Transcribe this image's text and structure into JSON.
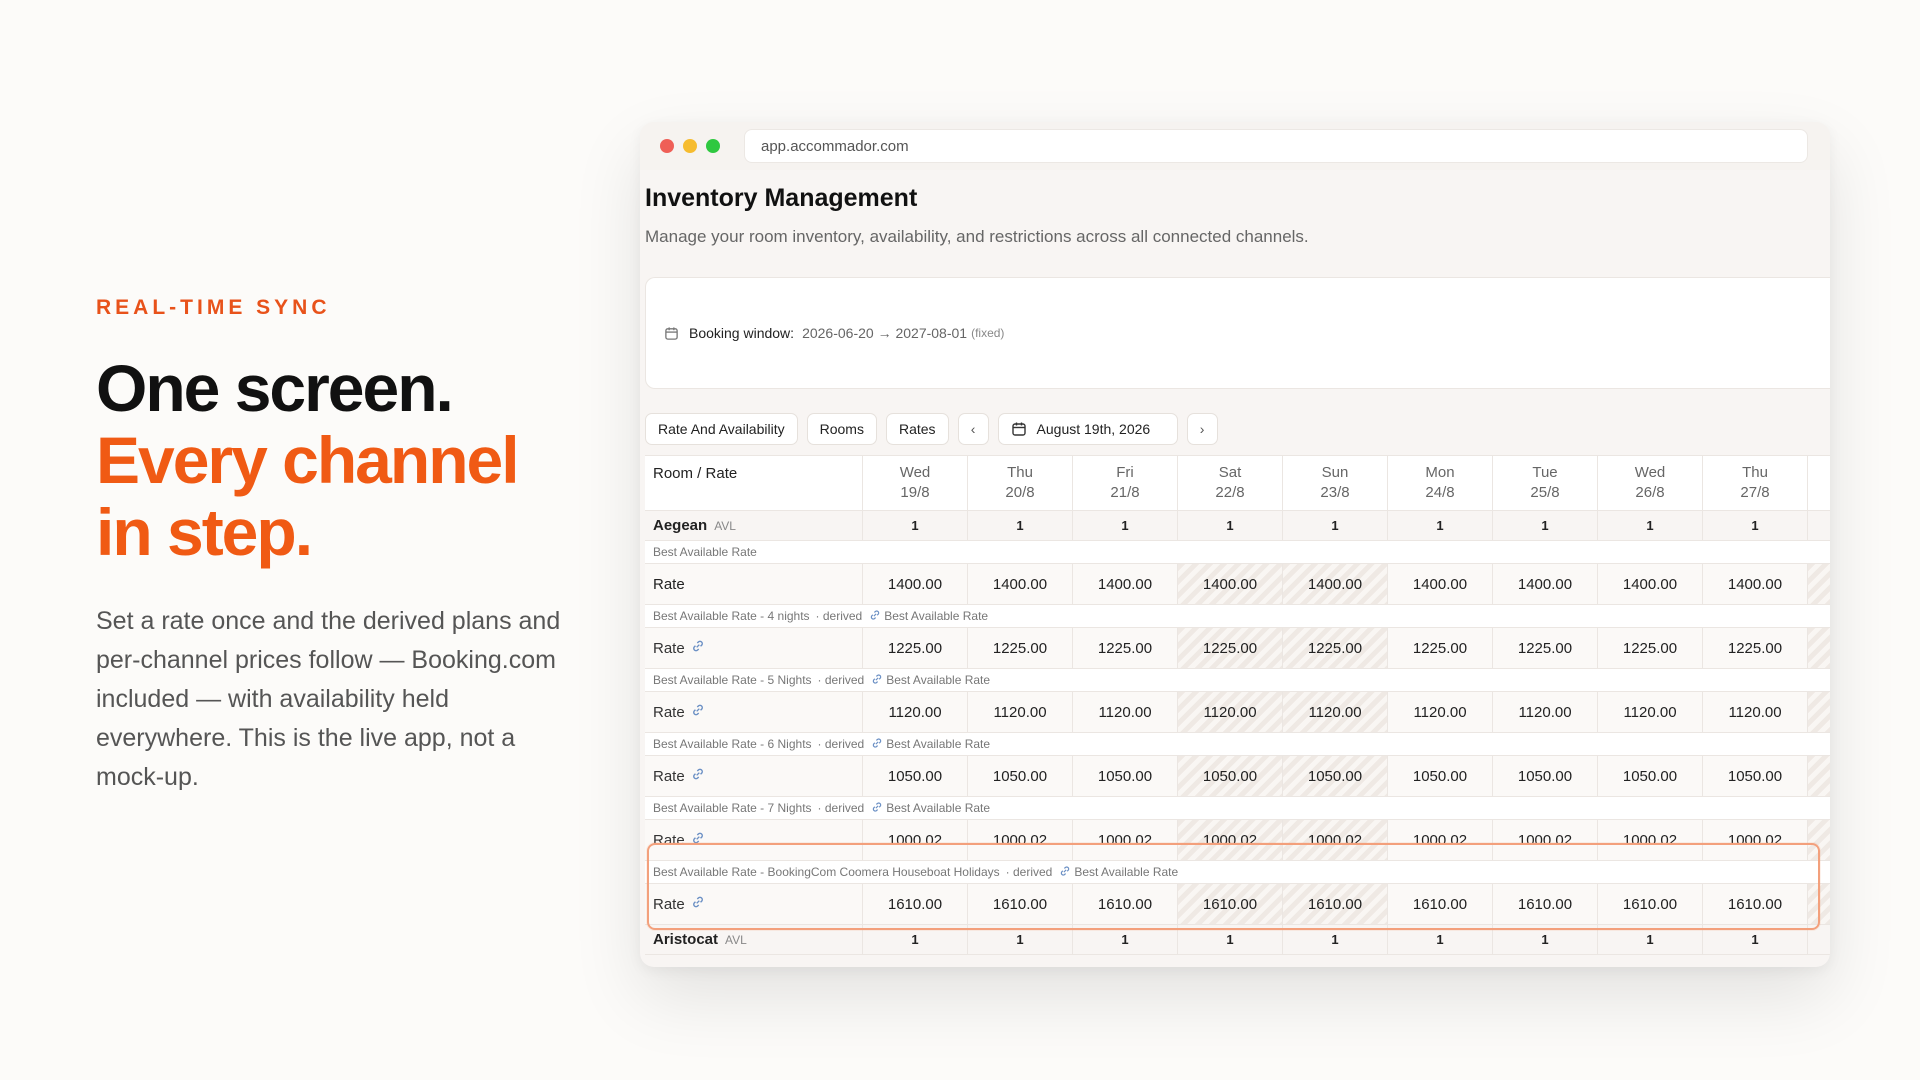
{
  "hero": {
    "eyebrow": "REAL-TIME SYNC",
    "headline_1": "One screen.",
    "headline_2": "Every channel",
    "headline_3": "in step.",
    "lede": "Set a rate once and the derived plans and per-channel prices follow — Booking.com included — with availability held everywhere. This is the live app, not a mock-up."
  },
  "browser": {
    "url": "app.accommador.com"
  },
  "page": {
    "title": "Inventory Management",
    "subtitle": "Manage your room inventory, availability, and restrictions across all connected channels."
  },
  "booking_window": {
    "label": "Booking window:",
    "value": "2026-06-20 → 2027-08-01",
    "note": "(fixed)"
  },
  "toolbar": {
    "tab_rate_availability": "Rate And Availability",
    "tab_rooms": "Rooms",
    "tab_rates": "Rates",
    "prev": "‹",
    "next": "›",
    "date": "August 19th, 2026"
  },
  "grid": {
    "header": "Room / Rate",
    "days": [
      {
        "dow": "Wed",
        "date": "19/8"
      },
      {
        "dow": "Thu",
        "date": "20/8"
      },
      {
        "dow": "Fri",
        "date": "21/8"
      },
      {
        "dow": "Sat",
        "date": "22/8"
      },
      {
        "dow": "Sun",
        "date": "23/8"
      },
      {
        "dow": "Mon",
        "date": "24/8"
      },
      {
        "dow": "Tue",
        "date": "25/8"
      },
      {
        "dow": "Wed",
        "date": "26/8"
      },
      {
        "dow": "Thu",
        "date": "27/8"
      }
    ],
    "room_1": {
      "name": "Aegean",
      "tag": "AVL",
      "avail": [
        "1",
        "1",
        "1",
        "1",
        "1",
        "1",
        "1",
        "1",
        "1"
      ]
    },
    "plans": [
      {
        "name": "Best Available Rate",
        "derived": "",
        "parent": "",
        "rate_label": "Rate",
        "values": [
          "1400.00",
          "1400.00",
          "1400.00",
          "1400.00",
          "1400.00",
          "1400.00",
          "1400.00",
          "1400.00",
          "1400.00"
        ]
      },
      {
        "name": "Best Available Rate - 4 nights",
        "derived": "· derived",
        "parent": "Best Available Rate",
        "rate_label": "Rate",
        "values": [
          "1225.00",
          "1225.00",
          "1225.00",
          "1225.00",
          "1225.00",
          "1225.00",
          "1225.00",
          "1225.00",
          "1225.00"
        ]
      },
      {
        "name": "Best Available Rate - 5 Nights",
        "derived": "· derived",
        "parent": "Best Available Rate",
        "rate_label": "Rate",
        "values": [
          "1120.00",
          "1120.00",
          "1120.00",
          "1120.00",
          "1120.00",
          "1120.00",
          "1120.00",
          "1120.00",
          "1120.00"
        ]
      },
      {
        "name": "Best Available Rate - 6 Nights",
        "derived": "· derived",
        "parent": "Best Available Rate",
        "rate_label": "Rate",
        "values": [
          "1050.00",
          "1050.00",
          "1050.00",
          "1050.00",
          "1050.00",
          "1050.00",
          "1050.00",
          "1050.00",
          "1050.00"
        ]
      },
      {
        "name": "Best Available Rate - 7 Nights",
        "derived": "· derived",
        "parent": "Best Available Rate",
        "rate_label": "Rate",
        "values": [
          "1000.02",
          "1000.02",
          "1000.02",
          "1000.02",
          "1000.02",
          "1000.02",
          "1000.02",
          "1000.02",
          "1000.02"
        ]
      },
      {
        "name": "Best Available Rate - BookingCom Coomera Houseboat Holidays",
        "derived": "· derived",
        "parent": "Best Available Rate",
        "rate_label": "Rate",
        "values": [
          "1610.00",
          "1610.00",
          "1610.00",
          "1610.00",
          "1610.00",
          "1610.00",
          "1610.00",
          "1610.00",
          "1610.00"
        ]
      }
    ],
    "room_2": {
      "name": "Aristocat",
      "tag": "AVL",
      "avail": [
        "1",
        "1",
        "1",
        "1",
        "1",
        "1",
        "1",
        "1",
        "1"
      ]
    }
  },
  "icons": {
    "calendar": "calendar-icon",
    "link": "link-icon"
  },
  "colors": {
    "accent": "#f05a14",
    "highlight": "#f3a07c"
  }
}
